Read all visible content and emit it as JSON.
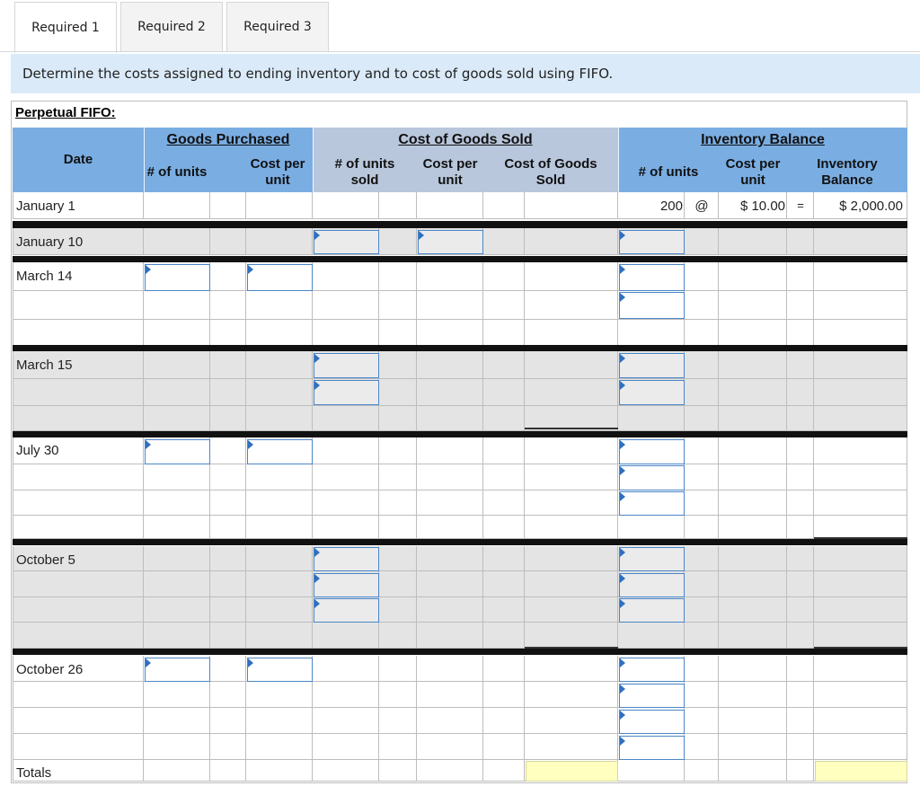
{
  "tabs": [
    {
      "label": "Required 1",
      "active": true
    },
    {
      "label": "Required 2",
      "active": false
    },
    {
      "label": "Required 3",
      "active": false
    }
  ],
  "instruction": "Determine the costs assigned to ending inventory and to cost of goods sold using FIFO.",
  "section_title": "Perpetual FIFO:",
  "header": {
    "date": "Date",
    "goods_purchased": "Goods Purchased",
    "cost_of_goods_sold": "Cost of Goods Sold",
    "inventory_balance": "Inventory Balance",
    "gp_units": "# of units",
    "gp_cost": "Cost per unit",
    "cogs_units": "# of units sold",
    "cogs_cost": "Cost per unit",
    "cogs_total": "Cost of Goods Sold",
    "ib_units": "# of units",
    "ib_cost": "Cost per unit",
    "ib_balance": "Inventory Balance"
  },
  "rows": {
    "january_1": {
      "date": "January 1",
      "units": "200",
      "at": "@",
      "cost": "$ 10.00",
      "equals": "=",
      "balance": "$ 2,000.00"
    },
    "january_10": {
      "date": "January 10"
    },
    "march_14": {
      "date": "March 14"
    },
    "march_15": {
      "date": "March 15"
    },
    "july_30": {
      "date": "July 30"
    },
    "october_5": {
      "date": "October 5"
    },
    "october_26": {
      "date": "October 26"
    },
    "totals": {
      "date": "Totals"
    }
  },
  "colors": {
    "header_blue": "#7aaee3",
    "header_gray": "#b9c7dc",
    "instruction_bg": "#daeaf8",
    "gray_row": "#e4e4e4",
    "totals_yellow": "#ffffc0",
    "input_border": "#4a86c8"
  }
}
